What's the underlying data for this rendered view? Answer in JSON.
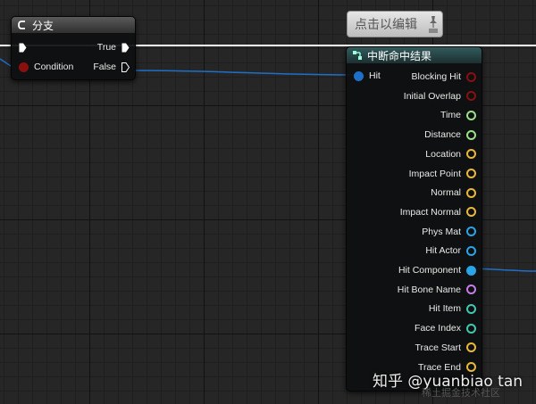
{
  "branch_node": {
    "title": "分支",
    "condition_label": "Condition",
    "true_label": "True",
    "false_label": "False"
  },
  "tooltip": {
    "text": "点击以编辑"
  },
  "hit_node": {
    "title": "中断命中结果",
    "input_label": "Hit",
    "outputs": [
      {
        "label": "Blocking Hit",
        "color": "#8a1010",
        "filled": false
      },
      {
        "label": "Initial Overlap",
        "color": "#8a1010",
        "filled": false
      },
      {
        "label": "Time",
        "color": "#9de08a",
        "filled": false
      },
      {
        "label": "Distance",
        "color": "#9de08a",
        "filled": false
      },
      {
        "label": "Location",
        "color": "#e8b838",
        "filled": false
      },
      {
        "label": "Impact Point",
        "color": "#e8b838",
        "filled": false
      },
      {
        "label": "Normal",
        "color": "#e8b838",
        "filled": false
      },
      {
        "label": "Impact Normal",
        "color": "#e8b838",
        "filled": false
      },
      {
        "label": "Phys Mat",
        "color": "#2aa4e6",
        "filled": false
      },
      {
        "label": "Hit Actor",
        "color": "#2aa4e6",
        "filled": false
      },
      {
        "label": "Hit Component",
        "color": "#2aa4e6",
        "filled": true
      },
      {
        "label": "Hit Bone Name",
        "color": "#c77ce8",
        "filled": false
      },
      {
        "label": "Hit Item",
        "color": "#3ec9b0",
        "filled": false
      },
      {
        "label": "Face Index",
        "color": "#3ec9b0",
        "filled": false
      },
      {
        "label": "Trace Start",
        "color": "#e8b838",
        "filled": false
      },
      {
        "label": "Trace End",
        "color": "#e8b838",
        "filled": false
      }
    ]
  },
  "colors": {
    "exec_wire": "#ffffff",
    "data_wire": "#1f6fc8",
    "bool_pin": "#8a1010"
  },
  "watermark": {
    "text": "知乎 @yuanbiao tan",
    "text2": "稀土掘金技术社区"
  }
}
